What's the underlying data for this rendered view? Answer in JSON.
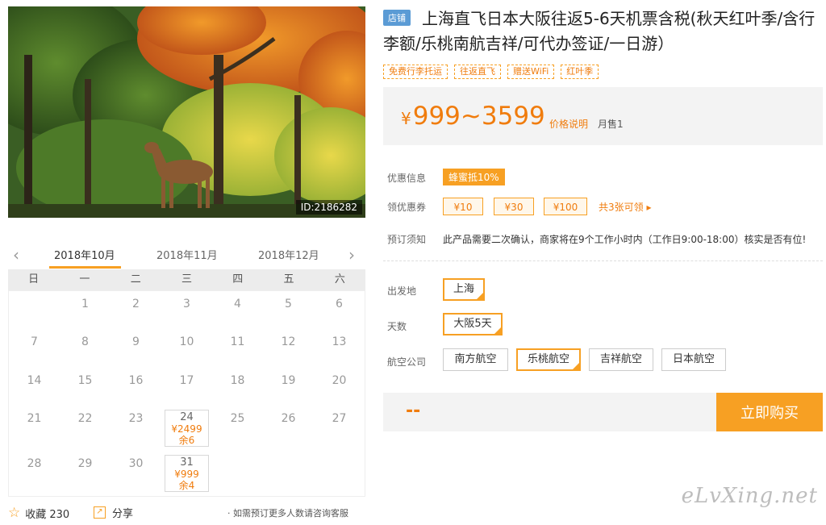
{
  "photo": {
    "id_label": "ID:2186282"
  },
  "calendar": {
    "months": [
      "2018年10月",
      "2018年11月",
      "2018年12月"
    ],
    "active_month": 0,
    "weekdays": [
      "日",
      "一",
      "二",
      "三",
      "四",
      "五",
      "六"
    ],
    "days": [
      {
        "d": ""
      },
      {
        "d": "1"
      },
      {
        "d": "2"
      },
      {
        "d": "3"
      },
      {
        "d": "4"
      },
      {
        "d": "5"
      },
      {
        "d": "6"
      },
      {
        "d": "7"
      },
      {
        "d": "8"
      },
      {
        "d": "9"
      },
      {
        "d": "10"
      },
      {
        "d": "11"
      },
      {
        "d": "12"
      },
      {
        "d": "13"
      },
      {
        "d": "14"
      },
      {
        "d": "15"
      },
      {
        "d": "16"
      },
      {
        "d": "17"
      },
      {
        "d": "18"
      },
      {
        "d": "19"
      },
      {
        "d": "20"
      },
      {
        "d": "21"
      },
      {
        "d": "22"
      },
      {
        "d": "23"
      },
      {
        "d": "24",
        "price": "¥2499",
        "stock": "余6"
      },
      {
        "d": "25"
      },
      {
        "d": "26"
      },
      {
        "d": "27"
      },
      {
        "d": "28"
      },
      {
        "d": "29"
      },
      {
        "d": "30"
      },
      {
        "d": "31",
        "price": "¥999",
        "stock": "余4"
      },
      {
        "d": ""
      },
      {
        "d": ""
      },
      {
        "d": ""
      }
    ]
  },
  "footer": {
    "favorite_label": "收藏 230",
    "share_label": "分享",
    "consult_text": "· 如需预订更多人数请咨询客服"
  },
  "product": {
    "store_badge": "店铺",
    "title": "上海直飞日本大阪往返5-6天机票含税(秋天红叶季/含行李额/乐桃南航吉祥/可代办签证/一日游）",
    "tags": [
      "免费行李托运",
      "往返直飞",
      "赠送WiFi",
      "红叶季"
    ],
    "price_yen": "¥",
    "price_range": "999~3599",
    "price_note": "价格说明",
    "monthly_sales": "月售1"
  },
  "info": {
    "promo_label": "优惠信息",
    "promo_tag": "蜂蜜抵10%",
    "coupon_label": "领优惠券",
    "coupons": [
      "¥10",
      "¥30",
      "¥100"
    ],
    "coupon_more": "共3张可领 ▸",
    "notice_label": "预订须知",
    "notice_text": "此产品需要二次确认，商家将在9个工作小时内（工作日9:00-18:00）核实是否有位!"
  },
  "options": {
    "depart_label": "出发地",
    "depart_values": [
      "上海"
    ],
    "days_label": "天数",
    "days_values": [
      "大阪5天"
    ],
    "airline_label": "航空公司",
    "airline_values": [
      "南方航空",
      "乐桃航空",
      "吉祥航空",
      "日本航空"
    ],
    "airline_selected": "乐桃航空"
  },
  "buy": {
    "price_placeholder": "--",
    "button_label": "立即购买"
  },
  "watermark": "eLvXing.net",
  "colors": {
    "accent": "#f7a023",
    "accent_text": "#f07c0d",
    "badge_blue": "#5b9bd5"
  }
}
